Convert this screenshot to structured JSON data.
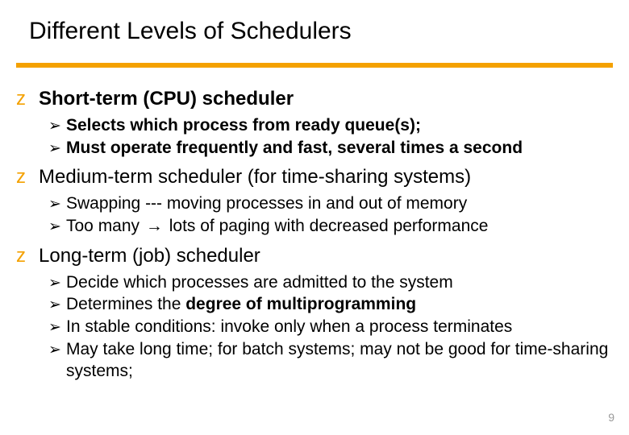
{
  "title": "Different Levels of Schedulers",
  "page_number": "9",
  "sections": [
    {
      "heading": "Short-term (CPU) scheduler",
      "heading_bold": true,
      "subs": [
        {
          "html": "<b>Selects which process from ready queue(s);</b>"
        },
        {
          "html": "<b>Must operate frequently and fast, several times a second</b>"
        }
      ]
    },
    {
      "heading": "Medium-term scheduler (for time-sharing systems)",
      "heading_bold": false,
      "subs": [
        {
          "html": "Swapping --- moving processes in and out of memory"
        },
        {
          "html": "Too many <span class='inline-arrow'>&#8594;</span> lots of paging with decreased performance"
        }
      ]
    },
    {
      "heading": "Long-term (job) scheduler",
      "heading_bold": false,
      "subs": [
        {
          "html": "Decide which processes are admitted to the system"
        },
        {
          "html": "Determines the <b>degree of multiprogramming</b>"
        },
        {
          "html": "In stable conditions: invoke only when a process terminates"
        },
        {
          "html": "May take long time; for batch systems; may not be good for time-sharing systems;"
        }
      ]
    }
  ]
}
